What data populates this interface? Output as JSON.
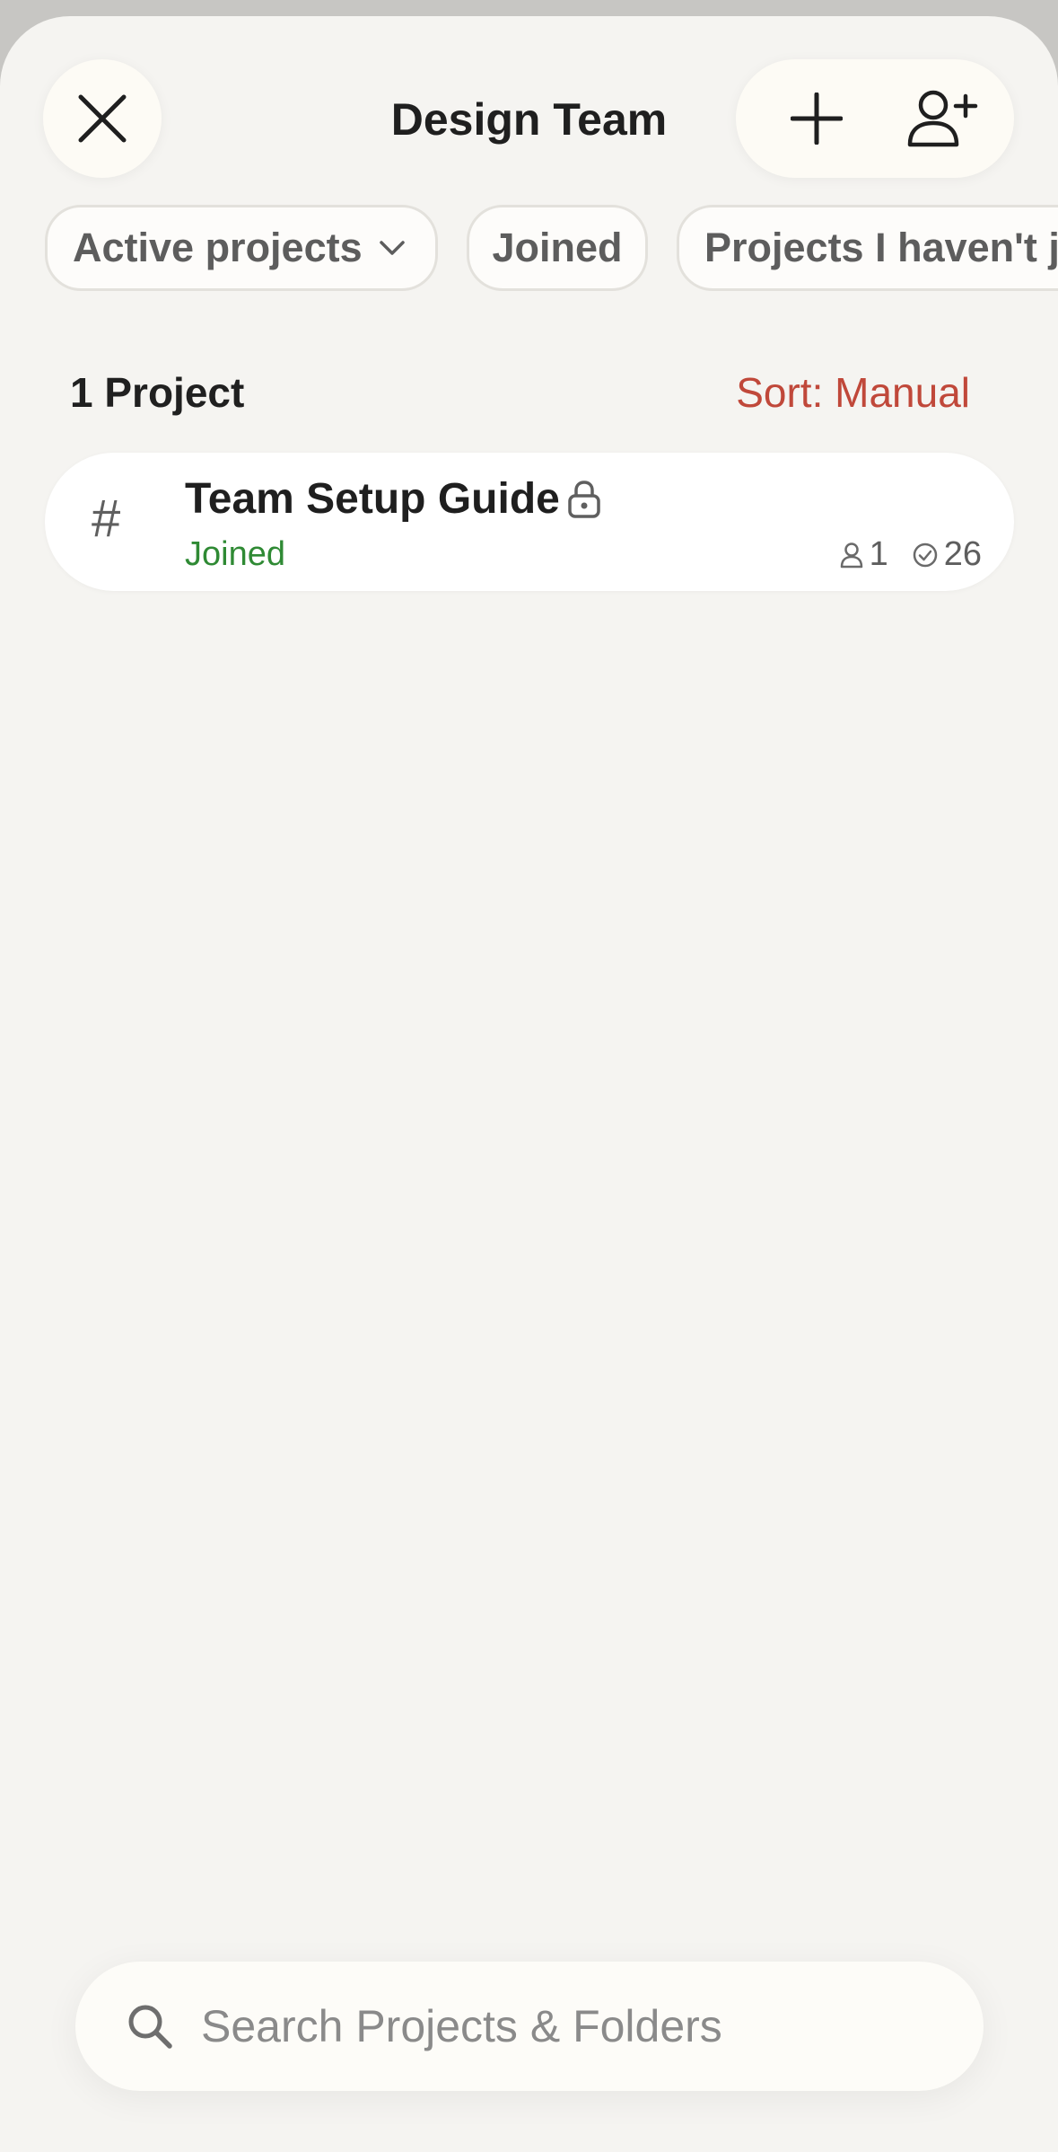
{
  "header": {
    "title": "Design Team"
  },
  "filters": [
    {
      "label": "Active projects"
    },
    {
      "label": "Joined"
    },
    {
      "label": "Projects I haven't joined"
    }
  ],
  "list": {
    "count_label": "1 Project",
    "sort_label": "Sort: Manual"
  },
  "projects": [
    {
      "name": "Team Setup Guide",
      "status": "Joined",
      "members": "1",
      "tasks": "26"
    }
  ],
  "search": {
    "placeholder": "Search Projects & Folders"
  },
  "colors": {
    "accent_red": "#c0483a",
    "joined_green": "#2f8a34",
    "background": "#f5f4f1"
  },
  "icons": [
    "close-icon",
    "plus-icon",
    "add-user-icon",
    "chevron-down-icon",
    "hash-icon",
    "lock-icon",
    "person-icon",
    "check-circle-icon",
    "search-icon"
  ]
}
